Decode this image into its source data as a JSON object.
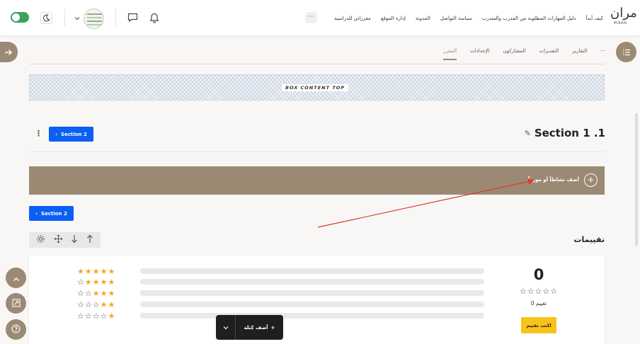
{
  "topbar": {
    "logo_mark": "مران",
    "logo_word": "MIRAN",
    "nav": [
      "مقرراتي للدراسية",
      "إدارة الموقع",
      "المدونة",
      "سياسة التواصل",
      "دليل المهارات المطلوبة من المدرب والمتدرب",
      "كيف أبدأ"
    ],
    "more": "···"
  },
  "tabs": [
    "المقرر",
    "الإعدادات",
    "المشاركون",
    "التقديرات",
    "التقارير",
    "···"
  ],
  "box_content_label": "BOX CONTENT TOP",
  "section": {
    "title": "Section 1 .1",
    "nav_button_1": "Section 2",
    "nav_button_2": "Section 2",
    "add_activity": "أضف نشاطاً أو مورداً"
  },
  "ratings": {
    "title": "تقييمات",
    "average": "0",
    "count_label": "0 تقييم",
    "write_button": "اكتب تقييم",
    "rows": [
      {
        "stars": 5,
        "fill": 0
      },
      {
        "stars": 4,
        "fill": 0
      },
      {
        "stars": 3,
        "fill": 0
      },
      {
        "stars": 2,
        "fill": 0
      },
      {
        "stars": 1,
        "fill": 0
      }
    ]
  },
  "bottom_toolbar": {
    "add_block": "أضف كتلة"
  },
  "colors": {
    "accent": "#9b8a73",
    "primary_button": "#0b5ff3",
    "star": "#f5a623",
    "write_button": "#f7c31a",
    "annotation_arrow": "#e03c2a"
  },
  "icons": {
    "toggle": "dark-mode-toggle",
    "moon": "moon-icon",
    "chat": "chat-icon",
    "bell": "bell-icon",
    "list": "list-icon",
    "arrow": "arrow-right-icon"
  }
}
